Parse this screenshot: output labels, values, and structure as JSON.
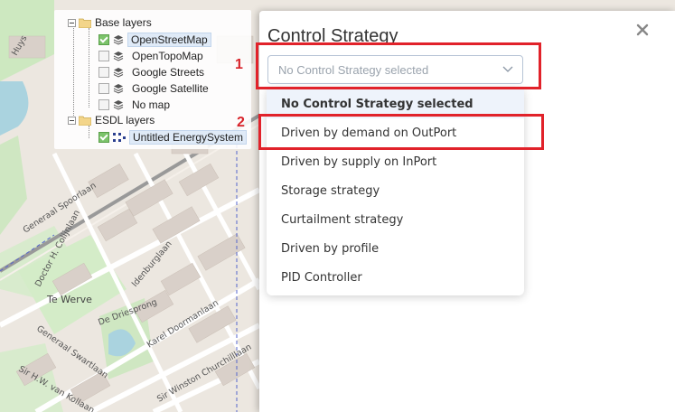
{
  "layer_tree": {
    "base_group": {
      "label": "Base layers"
    },
    "base_layers": [
      {
        "label": "OpenStreetMap",
        "checked": true,
        "selected": true
      },
      {
        "label": "OpenTopoMap",
        "checked": false,
        "selected": false
      },
      {
        "label": "Google Streets",
        "checked": false,
        "selected": false
      },
      {
        "label": "Google Satellite",
        "checked": false,
        "selected": false
      },
      {
        "label": "No map",
        "checked": false,
        "selected": false
      }
    ],
    "esdl_group": {
      "label": "ESDL layers"
    },
    "esdl_layers": [
      {
        "label": "Untitled EnergySystem",
        "checked": true,
        "selected": true
      }
    ]
  },
  "dialog": {
    "title": "Control Strategy",
    "close_icon": "close-icon",
    "select": {
      "value": "No Control Strategy selected",
      "chevron_icon": "chevron-down-icon"
    },
    "options": [
      {
        "label": "No Control Strategy selected",
        "active": true
      },
      {
        "label": "Driven by demand on OutPort",
        "active": false
      },
      {
        "label": "Driven by supply on InPort",
        "active": false
      },
      {
        "label": "Storage strategy",
        "active": false
      },
      {
        "label": "Curtailment strategy",
        "active": false
      },
      {
        "label": "Driven by profile",
        "active": false
      },
      {
        "label": "PID Controller",
        "active": false
      }
    ]
  },
  "annotations": [
    {
      "number": "1"
    },
    {
      "number": "2"
    }
  ],
  "map_labels": {
    "street_generaal_spoorlaan": "Generaal Spoorlaan",
    "street_doctor_colijnlaan": "Doctor H. Colijnlaan",
    "street_idenburglaan": "Idenburglaan",
    "street_te_werve": "Te Werve",
    "street_de_driesprong": "De Driesprong",
    "street_swartlaan": "Generaal Swartlaan",
    "street_karel_doormanlaan": "Karel Doormanlaan",
    "street_van_kollaan": "Sir H.W. van Kollaan",
    "street_winston": "Sir Winston Churchilllaan",
    "street_huys": "Huys"
  },
  "colors": {
    "annotation_red": "#e1222a",
    "selected_option_bg": "#eef3fb",
    "checkbox_green": "#7cc36b"
  }
}
